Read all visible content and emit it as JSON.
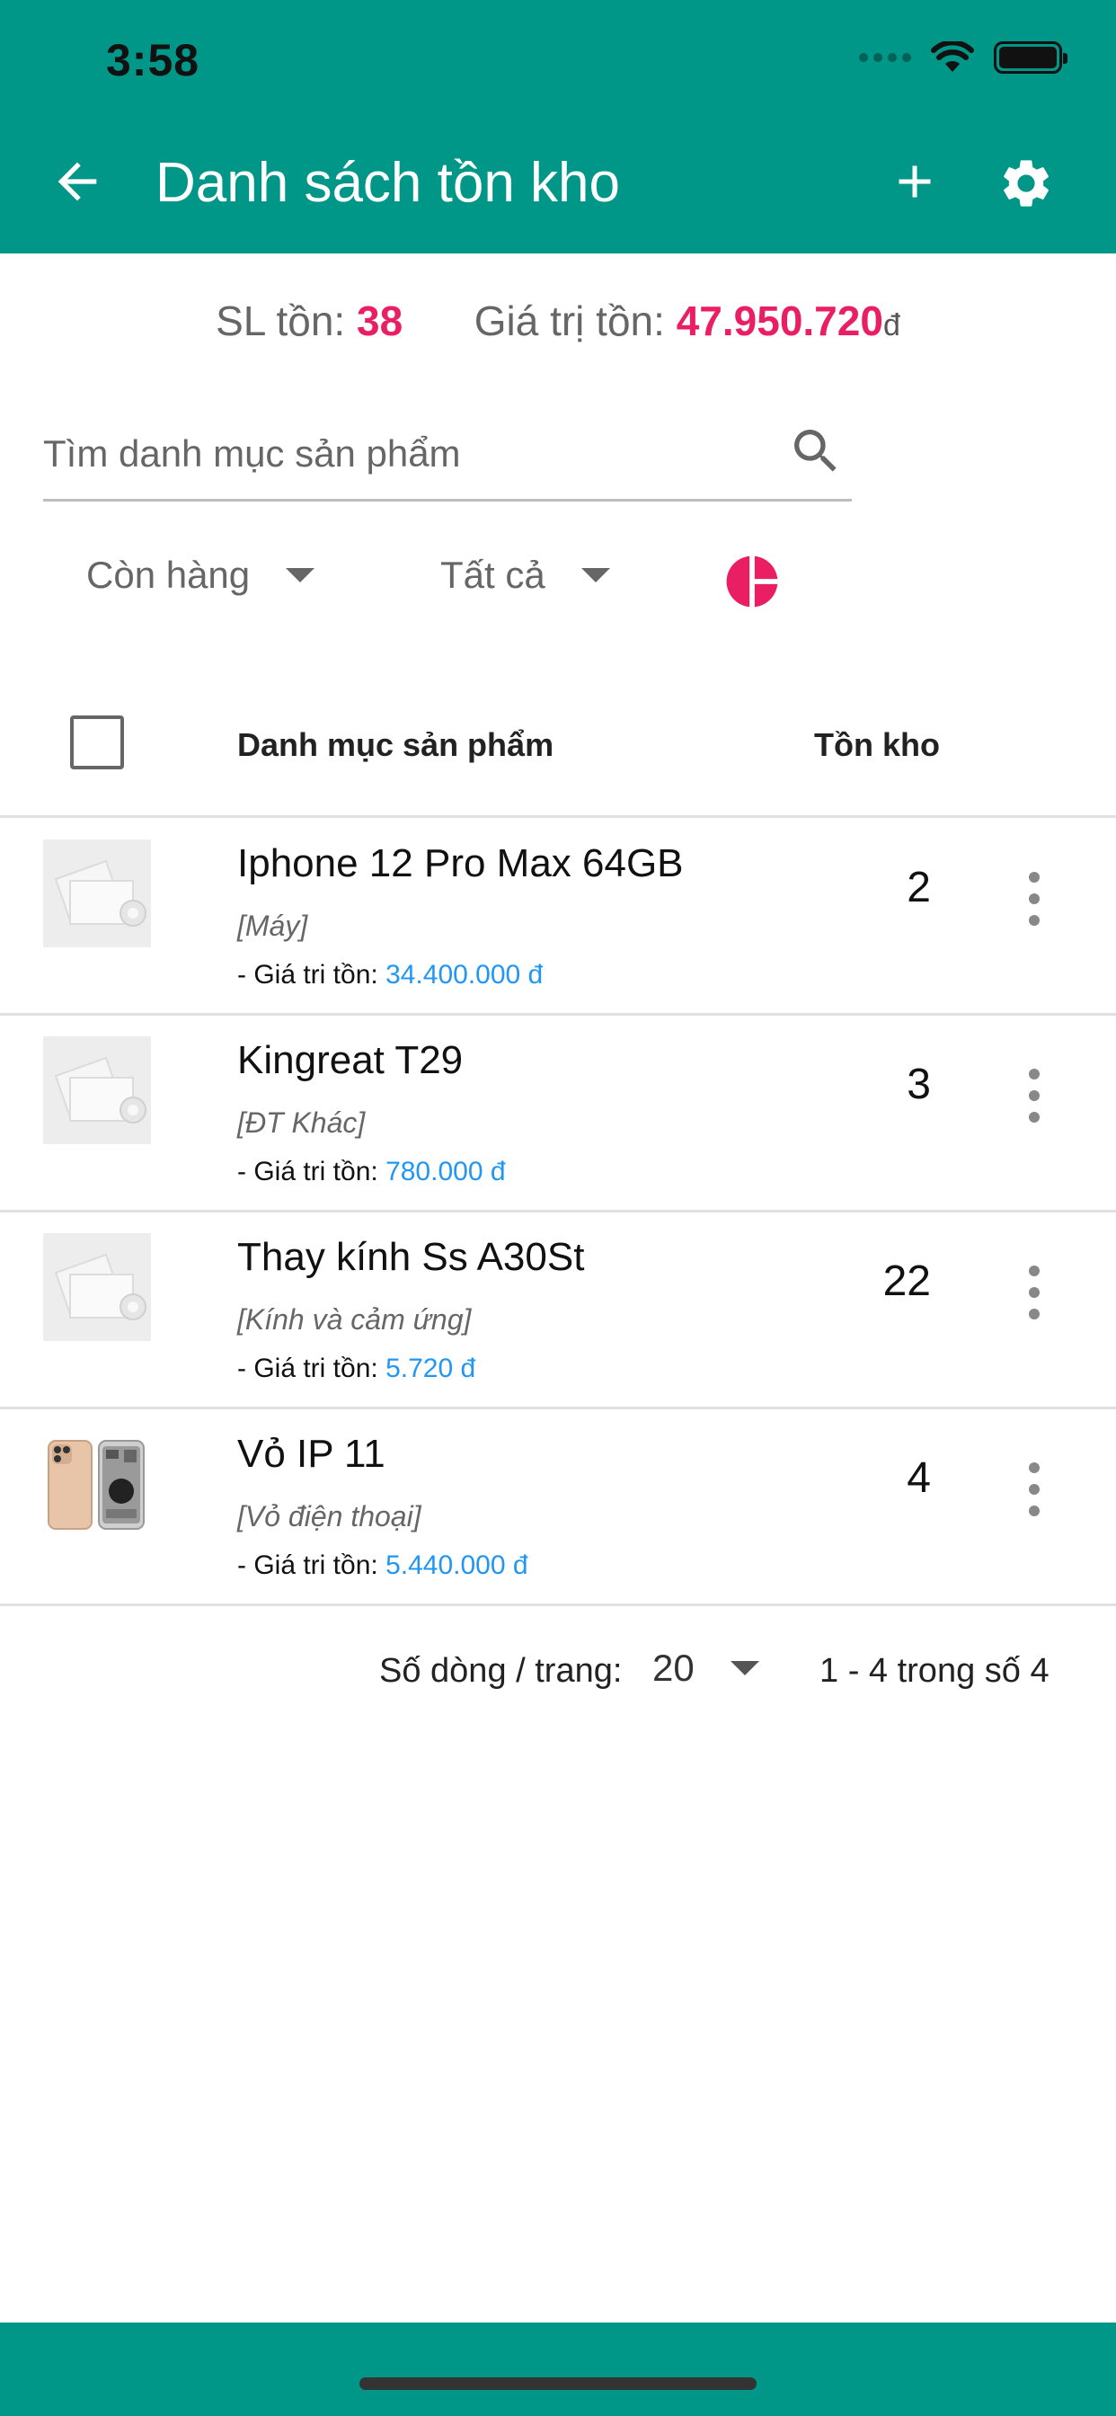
{
  "status_bar": {
    "time": "3:58"
  },
  "appbar": {
    "title": "Danh sách tồn kho",
    "back_icon": "arrow-left-icon",
    "add_icon": "plus-icon",
    "settings_icon": "gear-icon"
  },
  "summary": {
    "qty_label": "SL tồn:",
    "qty_value": "38",
    "value_label": "Giá trị tồn:",
    "value_amount": "47.950.720",
    "value_currency": "đ"
  },
  "search": {
    "placeholder": "Tìm danh mục sản phẩm",
    "value": ""
  },
  "filters": {
    "stock_status": "Còn hàng",
    "category": "Tất cả",
    "chart_icon": "pie-chart-icon"
  },
  "table": {
    "header_name": "Danh mục sản phẩm",
    "header_stock": "Tồn kho",
    "value_prefix": "- Giá tri tồn:",
    "rows": [
      {
        "name": "Iphone 12 Pro Max 64GB",
        "category": "[Máy]",
        "value": "34.400.000 đ",
        "qty": "2",
        "image": "placeholder-image-icon"
      },
      {
        "name": "Kingreat T29",
        "category": "[ĐT Khác]",
        "value": "780.000 đ",
        "qty": "3",
        "image": "placeholder-image-icon"
      },
      {
        "name": "Thay kính Ss A30St",
        "category": "[Kính và cảm ứng]",
        "value": "5.720 đ",
        "qty": "22",
        "image": "placeholder-image-icon"
      },
      {
        "name": "Vỏ IP 11",
        "category": "[Vỏ điện thoại]",
        "value": "5.440.000 đ",
        "qty": "4",
        "image": "iphone-housing-photo"
      }
    ]
  },
  "pagination": {
    "rows_label": "Số dòng / trang:",
    "rows_per_page": "20",
    "range": "1 - 4 trong số 4"
  },
  "colors": {
    "primary": "#009688",
    "accent": "#e91e63",
    "link": "#2196f3"
  }
}
